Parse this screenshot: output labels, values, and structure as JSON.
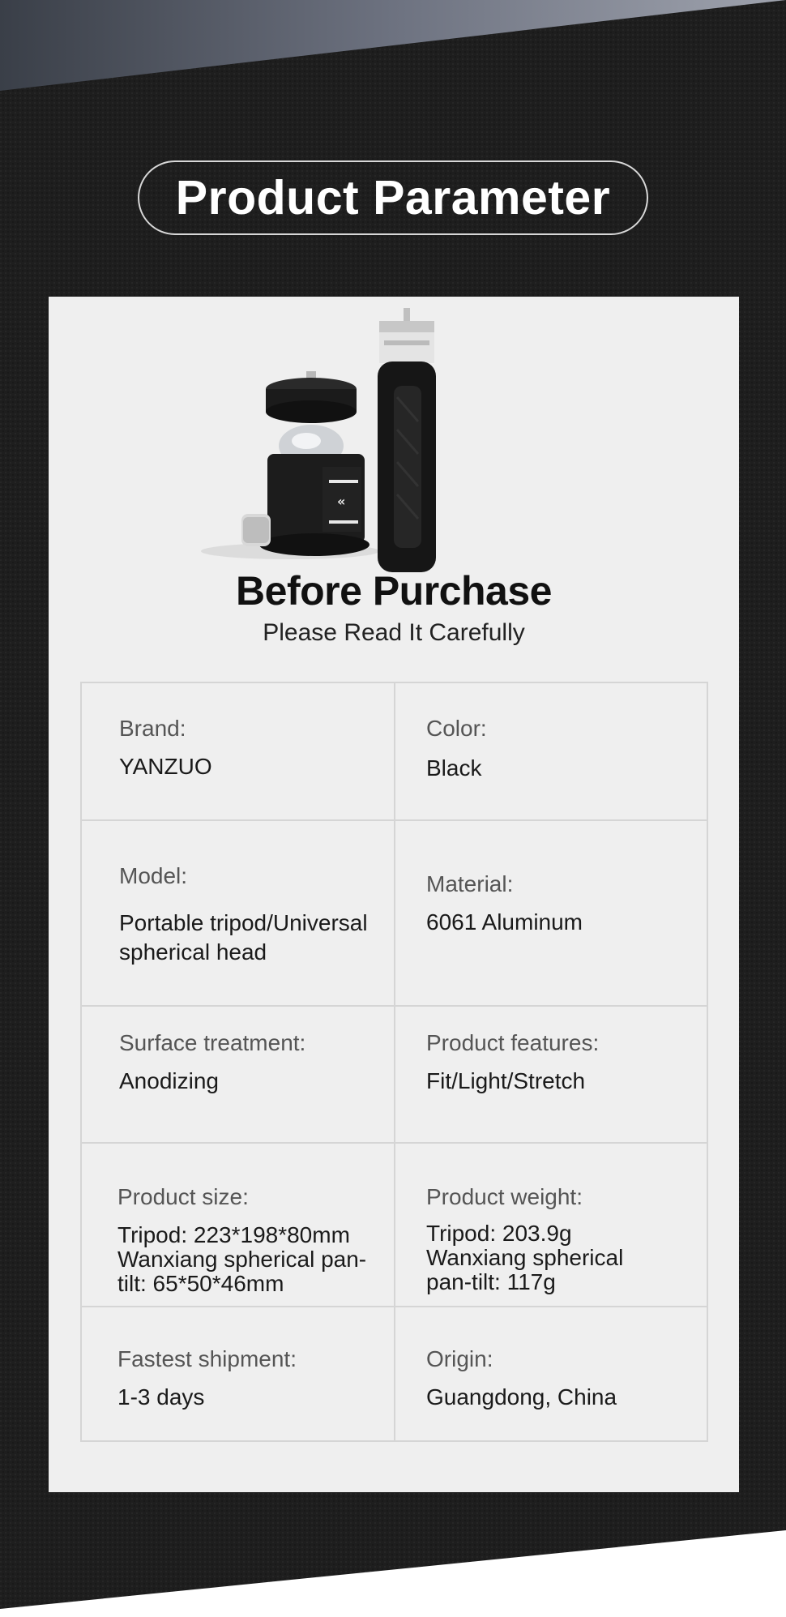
{
  "header": {
    "title": "Product Parameter"
  },
  "intro": {
    "heading": "Before Purchase",
    "subheading": "Please Read It Carefully"
  },
  "product_image": {
    "items": [
      "ball-head",
      "handheld-tripod"
    ]
  },
  "specs": [
    {
      "label": "Brand:",
      "value": "YANZUO"
    },
    {
      "label": "Color:",
      "value": "Black"
    },
    {
      "label": "Model:",
      "value": "Portable tripod/Universal spherical head"
    },
    {
      "label": "Material:",
      "value": "6061 Aluminum"
    },
    {
      "label": "Surface treatment:",
      "value": "Anodizing"
    },
    {
      "label": "Product features:",
      "value": "Fit/Light/Stretch"
    },
    {
      "label": "Product size:",
      "value": "Tripod: 223*198*80mm Wanxiang spherical pan-tilt: 65*50*46mm"
    },
    {
      "label": "Product weight:",
      "value": "Tripod: 203.9g Wanxiang spherical pan-tilt: 117g"
    },
    {
      "label": "Fastest shipment:",
      "value": "1-3 days"
    },
    {
      "label": "Origin:",
      "value": "Guangdong, China"
    }
  ],
  "colors": {
    "background_dark": "#1f1f1f",
    "card": "#efefef",
    "text_dark": "#111111",
    "grid_line": "#d5d5d5"
  }
}
